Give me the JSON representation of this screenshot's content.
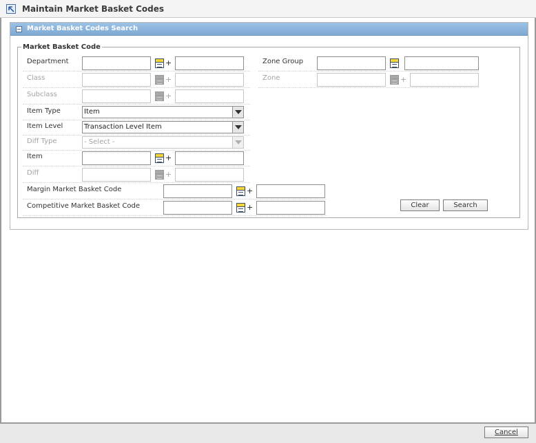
{
  "window": {
    "title": "Maintain Market Basket Codes"
  },
  "panel": {
    "title": "Market Basket Codes Search"
  },
  "fieldset": {
    "legend": "Market Basket Code"
  },
  "fields": {
    "department": {
      "label": "Department",
      "value": "",
      "desc": ""
    },
    "class": {
      "label": "Class",
      "value": "",
      "desc": ""
    },
    "subclass": {
      "label": "Subclass",
      "value": "",
      "desc": ""
    },
    "item_type": {
      "label": "Item Type",
      "selected": "Item"
    },
    "item_level": {
      "label": "Item Level",
      "selected": "Transaction Level Item"
    },
    "diff_type": {
      "label": "Diff Type",
      "selected": "- Select -"
    },
    "item": {
      "label": "Item",
      "value": "",
      "desc": ""
    },
    "diff": {
      "label": "Diff",
      "value": "",
      "desc": ""
    },
    "margin_mbc": {
      "label": "Margin Market Basket Code",
      "value": "",
      "desc": ""
    },
    "competitive_mbc": {
      "label": "Competitive Market Basket Code",
      "value": "",
      "desc": ""
    },
    "zone_group": {
      "label": "Zone Group",
      "value": "",
      "desc": ""
    },
    "zone": {
      "label": "Zone",
      "value": "",
      "desc": ""
    }
  },
  "icons": {
    "lov": "list-of-values-icon",
    "plus": "+"
  },
  "buttons": {
    "clear": "Clear",
    "search": "Search",
    "cancel": "Cancel"
  },
  "colors": {
    "panel_header": "#8db5dc",
    "lov_accent": "#f4d63a"
  }
}
